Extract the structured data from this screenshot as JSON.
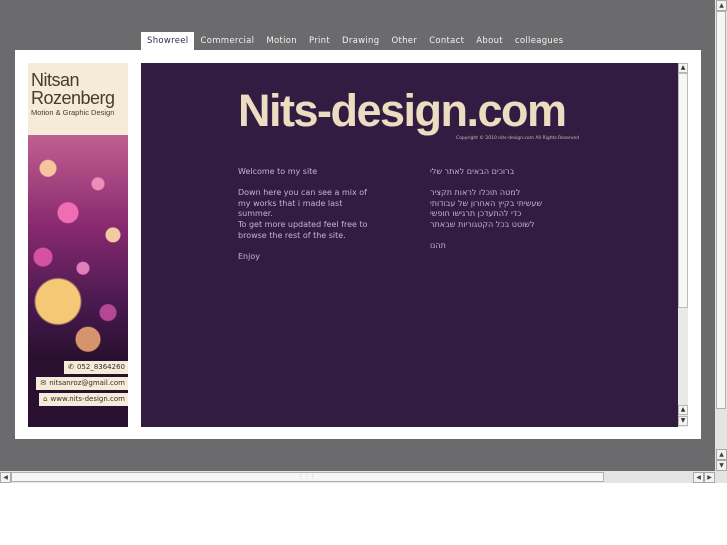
{
  "nav": {
    "items": [
      "Showreel",
      "Commercial",
      "Motion",
      "Print",
      "Drawing",
      "Other",
      "Contact",
      "About",
      "colleagues"
    ],
    "active_index": 0
  },
  "banner": {
    "name_line1": "Nitsan",
    "name_line2": "Rozenberg",
    "subtitle": "Motion & Graphic Design",
    "phone": "052_8364260",
    "email": "nitsanroz@gmail.com",
    "website": "www.nits-design.com",
    "icons": [
      "phone-icon",
      "mail-icon",
      "home-icon"
    ]
  },
  "main": {
    "logo": "Nits-design.com",
    "copyright": "Copyright © 2010 nits-design.com All Rights Reserved",
    "english": {
      "welcome": "Welcome to my site",
      "body_lines": [
        "Down here you can see a mix of",
        "my works that i made last summer.",
        "To get more updated feel free to",
        "browse the rest of the site."
      ],
      "enjoy": "Enjoy"
    },
    "hebrew": {
      "welcome": "ברוכים הבאים לאתר שלי",
      "body_lines": [
        "למטה תוכלו לראות תקציר",
        "שעשיתי בקיץ האחרון של עבודותי",
        "כדי להתעדכן תרגישו חופשי",
        "לשוטט בכל הקטגוריות שבאתר"
      ],
      "enjoy": "תהנו"
    }
  },
  "colors": {
    "page_background": "#6b6b6d",
    "main_panel": "#331c42",
    "logo": "#ecdcc0",
    "body_text": "#c4b3cc"
  }
}
